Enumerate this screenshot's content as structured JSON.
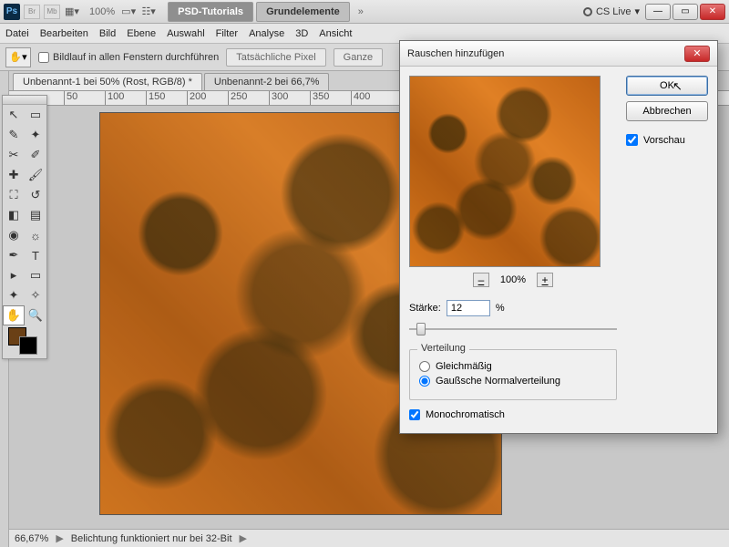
{
  "titlebar": {
    "zoom": "100%",
    "tabs": [
      "PSD-Tutorials",
      "Grundelemente"
    ],
    "cs_live": "CS Live"
  },
  "menu": [
    "Datei",
    "Bearbeiten",
    "Bild",
    "Ebene",
    "Auswahl",
    "Filter",
    "Analyse",
    "3D",
    "Ansicht"
  ],
  "optbar": {
    "scroll_all": "Bildlauf in allen Fenstern durchführen",
    "actual_pixels": "Tatsächliche Pixel",
    "fit": "Ganze"
  },
  "doc_tabs": [
    "Unbenannt-1 bei 50% (Rost, RGB/8) *",
    "Unbenannt-2 bei 66,7%"
  ],
  "ruler_ticks": [
    "50",
    "100",
    "150",
    "200",
    "250",
    "300",
    "350",
    "400"
  ],
  "status": {
    "zoom": "66,67%",
    "msg": "Belichtung funktioniert nur bei 32-Bit"
  },
  "swatch_fg": "#6a4016",
  "dialog": {
    "title": "Rauschen hinzufügen",
    "ok": "OK",
    "cancel": "Abbrechen",
    "preview_label": "Vorschau",
    "zoom": "100%",
    "strength_label": "Stärke:",
    "strength_value": "12",
    "strength_unit": "%",
    "dist_legend": "Verteilung",
    "dist_uniform": "Gleichmäßig",
    "dist_gauss": "Gaußsche Normalverteilung",
    "mono": "Monochromatisch"
  }
}
